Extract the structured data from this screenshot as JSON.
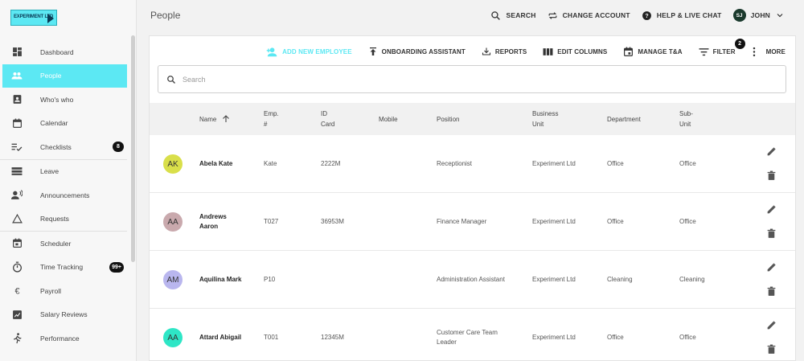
{
  "app": {
    "logo_text": "EXPERIMENT LTD",
    "page_title": "People"
  },
  "header": {
    "search_label": "SEARCH",
    "change_account_label": "CHANGE ACCOUNT",
    "help_label": "HELP & LIVE CHAT",
    "user_initials": "SJ",
    "user_name": "JOHN"
  },
  "sidebar": {
    "items": [
      {
        "label": "Dashboard",
        "icon": "dashboard-icon"
      },
      {
        "label": "People",
        "icon": "people-icon",
        "active": true
      },
      {
        "label": "Who's who",
        "icon": "contact-card-icon"
      },
      {
        "label": "Calendar",
        "icon": "calendar-icon"
      },
      {
        "label": "Checklists",
        "icon": "checklist-icon",
        "badge": "8"
      },
      {
        "label": "Leave",
        "icon": "leave-icon"
      },
      {
        "label": "Announcements",
        "icon": "announcement-icon"
      },
      {
        "label": "Requests",
        "icon": "triangle-icon"
      },
      {
        "label": "Scheduler",
        "icon": "scheduler-icon"
      },
      {
        "label": "Time Tracking",
        "icon": "stopwatch-icon",
        "badge": "99+"
      },
      {
        "label": "Payroll",
        "icon": "euro-icon"
      },
      {
        "label": "Salary Reviews",
        "icon": "salary-review-icon"
      },
      {
        "label": "Performance",
        "icon": "runner-icon"
      }
    ]
  },
  "toolbar": {
    "add_employee": "ADD NEW EMPLOYEE",
    "onboarding": "ONBOARDING ASSISTANT",
    "reports": "REPORTS",
    "edit_columns": "EDIT COLUMNS",
    "manage_ta": "MANAGE T&A",
    "filter": "FILTER",
    "filter_count": "2",
    "more": "MORE"
  },
  "search": {
    "placeholder": "Search",
    "value": ""
  },
  "table": {
    "columns": {
      "name": "Name",
      "emp_no": "Emp.\n#",
      "id_card": "ID\nCard",
      "mobile": "Mobile",
      "position": "Position",
      "business_unit": "Business\nUnit",
      "department": "Department",
      "sub_unit": "Sub-\nUnit"
    },
    "rows": [
      {
        "initials": "AK",
        "avatar_color": "#d9df4a",
        "name": "Abela Kate",
        "emp_no": "Kate",
        "id_card": "2222M",
        "mobile": "",
        "position": "Receptionist",
        "business_unit": "Experiment Ltd",
        "department": "Office",
        "sub_unit": "Office"
      },
      {
        "initials": "AA",
        "avatar_color": "#c9a9ad",
        "name": "Andrews\nAaron",
        "emp_no": "T027",
        "id_card": "36953M",
        "mobile": "",
        "position": "Finance Manager",
        "business_unit": "Experiment Ltd",
        "department": "Office",
        "sub_unit": "Office"
      },
      {
        "initials": "AM",
        "avatar_color": "#b9b6ee",
        "name": "Aquilina Mark",
        "emp_no": "P10",
        "id_card": "",
        "mobile": "",
        "position": "Administration Assistant",
        "business_unit": "Experiment Ltd",
        "department": "Cleaning",
        "sub_unit": "Cleaning"
      },
      {
        "initials": "AA",
        "avatar_color": "#2ee6c6",
        "name": "Attard Abigail",
        "emp_no": "T001",
        "id_card": "12345M",
        "mobile": "",
        "position": "Customer Care Team\nLeader",
        "business_unit": "Experiment Ltd",
        "department": "Office",
        "sub_unit": "Office"
      }
    ]
  },
  "colors": {
    "accent": "#5ce8f3",
    "badge": "#111111"
  }
}
